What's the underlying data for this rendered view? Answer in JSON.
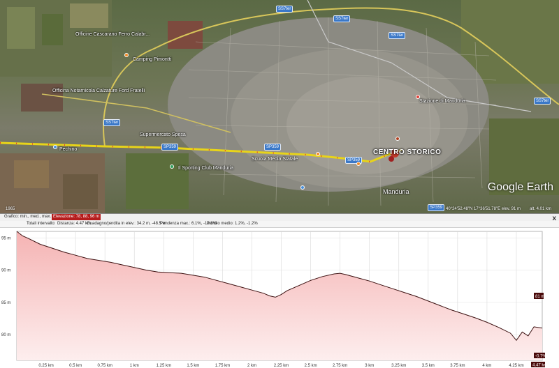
{
  "colors": {
    "route": "#e8d419",
    "route_dots": "#e53030",
    "profile_line": "#3b1010",
    "profile_fill_top": "#f5b3b3",
    "profile_fill_bottom": "#fdeeee",
    "grid": "#d9d9d9",
    "badge": "#3a78c8"
  },
  "map": {
    "labels": [
      "Officine Cascarano Ferro Calabr...",
      "Camping Pimontti",
      "Officina Notarnicola Calzature Ford Fratelli",
      "Pechino",
      "Supermercato Spesa",
      "Il Sporting Club Manduria",
      "CENTRO STORICO",
      "Manduria",
      "Stazione di Manduria",
      "Scuola Media Statale"
    ],
    "road_badges": [
      "SS7ter",
      "SS7ter",
      "SS7ter",
      "SS7ter",
      "SS7ter",
      "SP359",
      "SP359",
      "SP359",
      "SP359"
    ],
    "brand": "Google Earth",
    "status_left": "1965",
    "status_right": [
      "40°24'52.48\"N  17°36'51.78\"E  elev.  91 m",
      "alt.  4.01 km"
    ]
  },
  "profile": {
    "header": {
      "graph_label": "Grafico: min., med., max.",
      "elevation_label": "Elevazione: 78, 88, 96 m"
    },
    "stats": {
      "totals_label": "Totali intervallo:",
      "distance": "Distanza: 4.47 km",
      "gain_loss": "Guadagno/perdita in elev.: 34.2 m, -48.5 m",
      "max_slope": "Pendenza max.: 6.1%, -13.9%",
      "avg_slope": "Pendio medio: 1.2%, -1.2%"
    },
    "close_label": "x",
    "marker_top": "81 m",
    "marker_bottom_pct": "-0.7%",
    "marker_bottom_km": "4.47 km"
  },
  "chart_data": {
    "type": "area",
    "title": "",
    "xlabel": "",
    "ylabel": "",
    "xlim": [
      0,
      4.47
    ],
    "ylim": [
      76,
      96
    ],
    "grid": true,
    "y_ticks": [
      "95 m",
      "90 m",
      "85 m",
      "80 m"
    ],
    "y_tick_values": [
      95,
      90,
      85,
      80
    ],
    "x_ticks": [
      "0.25 km",
      "0.5 km",
      "0.75 km",
      "1 km",
      "1.25 km",
      "1.5 km",
      "1.75 km",
      "2 km",
      "2.25 km",
      "2.5 km",
      "2.75 km",
      "3 km",
      "3.25 km",
      "3.5 km",
      "3.75 km",
      "4 km",
      "4.25 km"
    ],
    "x_tick_values": [
      0.25,
      0.5,
      0.75,
      1.0,
      1.25,
      1.5,
      1.75,
      2.0,
      2.25,
      2.5,
      2.75,
      3.0,
      3.25,
      3.5,
      3.75,
      4.0,
      4.25
    ],
    "series": [
      {
        "x": [
          0,
          0.05,
          0.1,
          0.2,
          0.3,
          0.4,
          0.5,
          0.6,
          0.7,
          0.8,
          0.9,
          1.0,
          1.1,
          1.2,
          1.3,
          1.4,
          1.5,
          1.6,
          1.7,
          1.8,
          1.9,
          2.0,
          2.1,
          2.15,
          2.2,
          2.25,
          2.3,
          2.4,
          2.5,
          2.6,
          2.7,
          2.75,
          2.8,
          2.9,
          3.0,
          3.1,
          3.2,
          3.3,
          3.4,
          3.5,
          3.6,
          3.7,
          3.8,
          3.9,
          4.0,
          4.1,
          4.2,
          4.25,
          4.3,
          4.35,
          4.4,
          4.47
        ],
        "y": [
          96,
          95.3,
          94.9,
          94.0,
          93.4,
          92.8,
          92.3,
          91.8,
          91.5,
          91.2,
          90.8,
          90.4,
          90.0,
          89.7,
          89.6,
          89.5,
          89.2,
          88.9,
          88.4,
          87.9,
          87.4,
          86.9,
          86.4,
          86.0,
          85.8,
          86.2,
          86.8,
          87.6,
          88.4,
          89.0,
          89.4,
          89.5,
          89.3,
          88.8,
          88.3,
          87.7,
          87.1,
          86.5,
          85.9,
          85.2,
          84.5,
          83.8,
          83.2,
          82.6,
          81.9,
          81.1,
          80.2,
          79.1,
          80.4,
          79.8,
          81.2,
          81.0
        ]
      }
    ]
  }
}
